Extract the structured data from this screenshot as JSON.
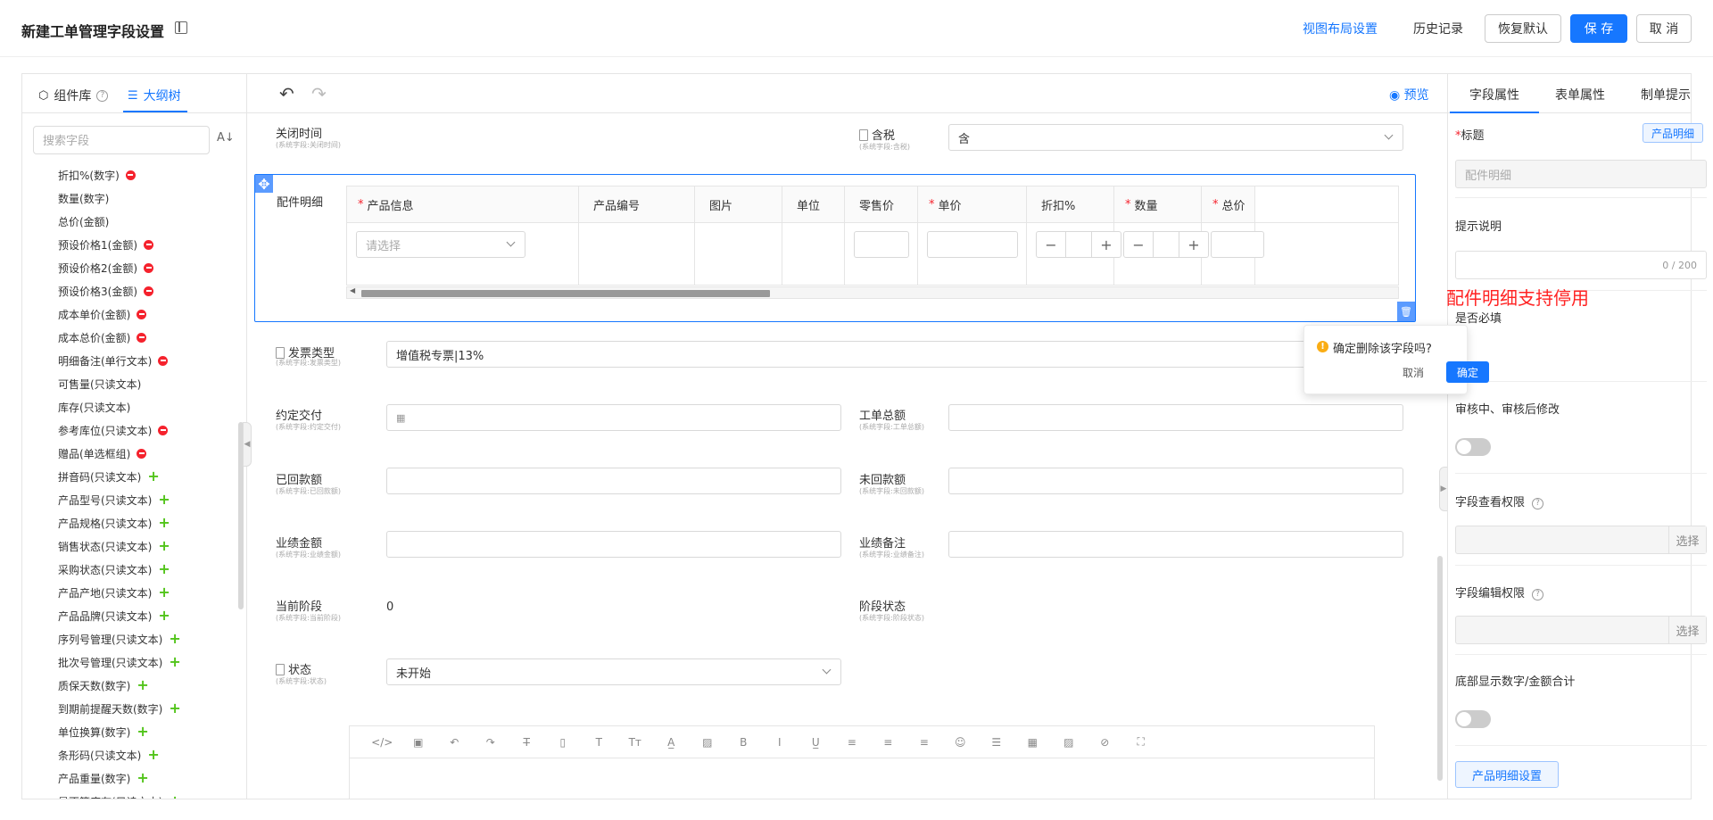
{
  "header": {
    "title": "新建工单管理字段设置",
    "view_layout": "视图布局设置",
    "history": "历史记录",
    "restore_default": "恢复默认",
    "save": "保 存",
    "cancel": "取 消"
  },
  "left_panel": {
    "tab_components": "组件库",
    "tab_outline": "大纲树",
    "search_placeholder": "搜索字段",
    "fields": [
      {
        "label": "折扣%(数字)",
        "badge": "remove"
      },
      {
        "label": "数量(数字)",
        "badge": ""
      },
      {
        "label": "总价(金额)",
        "badge": ""
      },
      {
        "label": "预设价格1(金额)",
        "badge": "remove"
      },
      {
        "label": "预设价格2(金额)",
        "badge": "remove"
      },
      {
        "label": "预设价格3(金额)",
        "badge": "remove"
      },
      {
        "label": "成本单价(金额)",
        "badge": "remove"
      },
      {
        "label": "成本总价(金额)",
        "badge": "remove"
      },
      {
        "label": "明细备注(单行文本)",
        "badge": "remove"
      },
      {
        "label": "可售量(只读文本)",
        "badge": ""
      },
      {
        "label": "库存(只读文本)",
        "badge": ""
      },
      {
        "label": "参考库位(只读文本)",
        "badge": "remove"
      },
      {
        "label": "赠品(单选框组)",
        "badge": "remove"
      },
      {
        "label": "拼音码(只读文本)",
        "badge": "add"
      },
      {
        "label": "产品型号(只读文本)",
        "badge": "add"
      },
      {
        "label": "产品规格(只读文本)",
        "badge": "add"
      },
      {
        "label": "销售状态(只读文本)",
        "badge": "add"
      },
      {
        "label": "采购状态(只读文本)",
        "badge": "add"
      },
      {
        "label": "产品产地(只读文本)",
        "badge": "add"
      },
      {
        "label": "产品品牌(只读文本)",
        "badge": "add"
      },
      {
        "label": "序列号管理(只读文本)",
        "badge": "add"
      },
      {
        "label": "批次号管理(只读文本)",
        "badge": "add"
      },
      {
        "label": "质保天数(数字)",
        "badge": "add"
      },
      {
        "label": "到期前提醒天数(数字)",
        "badge": "add"
      },
      {
        "label": "单位换算(数字)",
        "badge": "add"
      },
      {
        "label": "条形码(只读文本)",
        "badge": "add"
      },
      {
        "label": "产品重量(数字)",
        "badge": "add"
      },
      {
        "label": "是否算库存(只读文本)",
        "badge": "add"
      }
    ]
  },
  "center": {
    "preview": "预览",
    "close_time": {
      "label": "关闭时间",
      "sub": "(系统字段:关闭时间)"
    },
    "tax": {
      "label": "含税",
      "sub": "(系统字段:含税)",
      "value": "含"
    },
    "accessory": {
      "label": "配件明细",
      "columns": [
        {
          "label": "产品信息",
          "required": "*"
        },
        {
          "label": "产品编号",
          "required": ""
        },
        {
          "label": "图片",
          "required": ""
        },
        {
          "label": "单位",
          "required": ""
        },
        {
          "label": "零售价",
          "required": ""
        },
        {
          "label": "单价",
          "required": "*"
        },
        {
          "label": "折扣%",
          "required": ""
        },
        {
          "label": "数量",
          "required": "*"
        },
        {
          "label": "总价",
          "required": "*"
        }
      ],
      "select_placeholder": "请选择"
    },
    "invoice_type": {
      "label": "发票类型",
      "sub": "(系统字段:发票类型)",
      "value": "增值税专票|13%"
    },
    "agreed_delivery": {
      "label": "约定交付",
      "sub": "(系统字段:约定交付)"
    },
    "order_total": {
      "label": "工单总额",
      "sub": "(系统字段:工单总额)"
    },
    "received": {
      "label": "已回款额",
      "sub": "(系统字段:已回款额)"
    },
    "unreceived": {
      "label": "未回款额",
      "sub": "(系统字段:未回款额)"
    },
    "perf_amount": {
      "label": "业绩金额",
      "sub": "(系统字段:业绩金额)"
    },
    "perf_note": {
      "label": "业绩备注",
      "sub": "(系统字段:业绩备注)"
    },
    "current_stage": {
      "label": "当前阶段",
      "sub": "(系统字段:当前阶段)",
      "value": "0"
    },
    "stage_status": {
      "label": "阶段状态",
      "sub": "(系统字段:阶段状态)"
    },
    "status": {
      "label": "状态",
      "sub": "(系统字段:状态)",
      "value": "未开始"
    }
  },
  "annotation": "配件明细支持停用",
  "popconfirm": {
    "text": "确定删除该字段吗?",
    "cancel": "取消",
    "ok": "确定"
  },
  "right_panel": {
    "tab_field": "字段属性",
    "tab_form": "表单属性",
    "tab_hint": "制单提示",
    "title_label": "标题",
    "title_required": "*",
    "title_tag": "产品明细",
    "title_value": "配件明细",
    "hint_label": "提示说明",
    "hint_counter": "0 / 200",
    "required_label": "是否必填",
    "edit_in_review_label": "审核中、审核后修改",
    "view_perm_label": "字段查看权限",
    "edit_perm_label": "字段编辑权限",
    "choose": "选择",
    "bottom_sum_label": "底部显示数字/金额合计",
    "product_detail_settings": "产品明细设置"
  }
}
